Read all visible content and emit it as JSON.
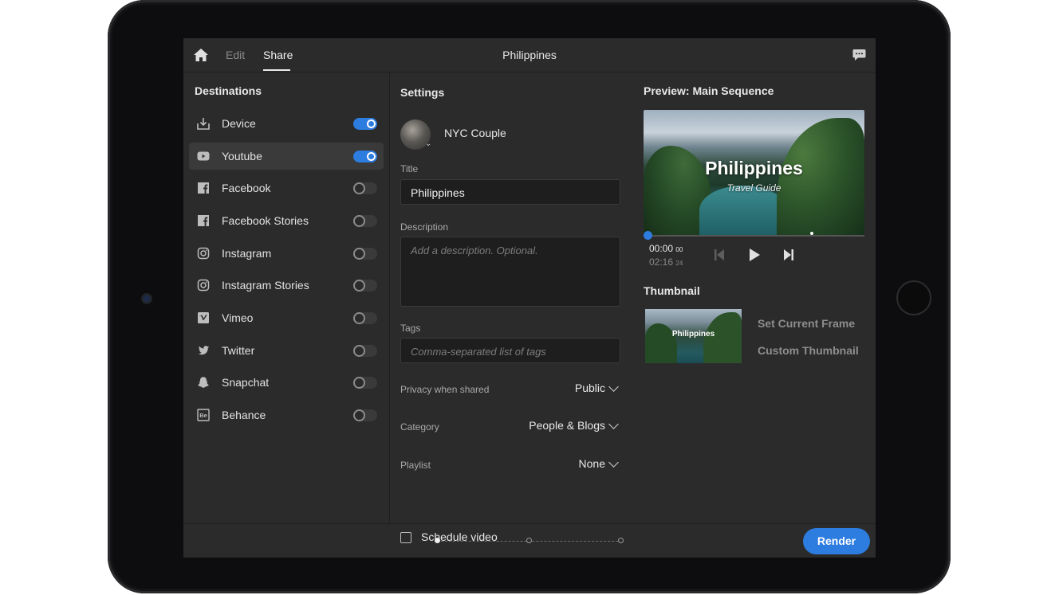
{
  "header": {
    "tabs": [
      {
        "label": "Edit"
      },
      {
        "label": "Share"
      }
    ],
    "project_title": "Philippines"
  },
  "destinations": {
    "title": "Destinations",
    "items": [
      {
        "label": "Device",
        "icon": "download-icon",
        "enabled": true
      },
      {
        "label": "Youtube",
        "icon": "youtube-icon",
        "enabled": true,
        "selected": true
      },
      {
        "label": "Facebook",
        "icon": "facebook-icon",
        "enabled": false
      },
      {
        "label": "Facebook Stories",
        "icon": "facebook-icon",
        "enabled": false
      },
      {
        "label": "Instagram",
        "icon": "instagram-icon",
        "enabled": false
      },
      {
        "label": "Instagram Stories",
        "icon": "instagram-icon",
        "enabled": false
      },
      {
        "label": "Vimeo",
        "icon": "vimeo-icon",
        "enabled": false
      },
      {
        "label": "Twitter",
        "icon": "twitter-icon",
        "enabled": false
      },
      {
        "label": "Snapchat",
        "icon": "snapchat-icon",
        "enabled": false
      },
      {
        "label": "Behance",
        "icon": "behance-icon",
        "enabled": false
      }
    ]
  },
  "settings": {
    "title": "Settings",
    "account_name": "NYC Couple",
    "title_label": "Title",
    "title_value": "Philippines",
    "description_label": "Description",
    "description_placeholder": "Add a description. Optional.",
    "tags_label": "Tags",
    "tags_placeholder": "Comma-separated list of tags",
    "privacy_label": "Privacy when shared",
    "privacy_value": "Public",
    "category_label": "Category",
    "category_value": "People & Blogs",
    "playlist_label": "Playlist",
    "playlist_value": "None",
    "schedule_label": "Schedule video"
  },
  "preview": {
    "title": "Preview: Main Sequence",
    "overlay_title": "Philippines",
    "overlay_subtitle": "Travel Guide",
    "time_current": "00:00",
    "time_current_frames": "00",
    "time_duration": "02:16",
    "time_duration_frames": "24"
  },
  "thumbnail": {
    "title": "Thumbnail",
    "image_title": "Philippines",
    "set_current_frame": "Set Current Frame",
    "custom_thumbnail": "Custom Thumbnail"
  },
  "footer": {
    "render_label": "Render"
  },
  "colors": {
    "accent": "#2d7ce0",
    "background": "#2b2b2b"
  }
}
